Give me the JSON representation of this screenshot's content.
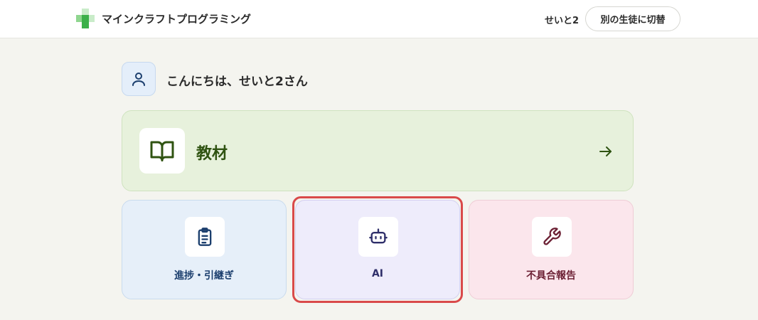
{
  "header": {
    "app_title": "マインクラフトプログラミング",
    "user_name": "せいと2",
    "switch_label": "別の生徒に切替",
    "logo_icon": "green-cross-logo-icon"
  },
  "greeting": {
    "text": "こんにちは、せいと2さん",
    "icon": "user-icon"
  },
  "materials": {
    "label": "教材",
    "icon": "open-book-icon",
    "arrow_icon": "arrow-right-icon"
  },
  "cards": [
    {
      "label": "進捗・引継ぎ",
      "icon": "clipboard-icon"
    },
    {
      "label": "AI",
      "icon": "robot-icon"
    },
    {
      "label": "不具合報告",
      "icon": "wrench-icon"
    }
  ],
  "colors": {
    "materials_accent": "#2f5311",
    "progress_accent": "#1c3f6e",
    "ai_accent": "#2f2f6a",
    "report_accent": "#6b1f33",
    "highlight": "#d94a4a",
    "logo_green": "#3cb04a"
  }
}
